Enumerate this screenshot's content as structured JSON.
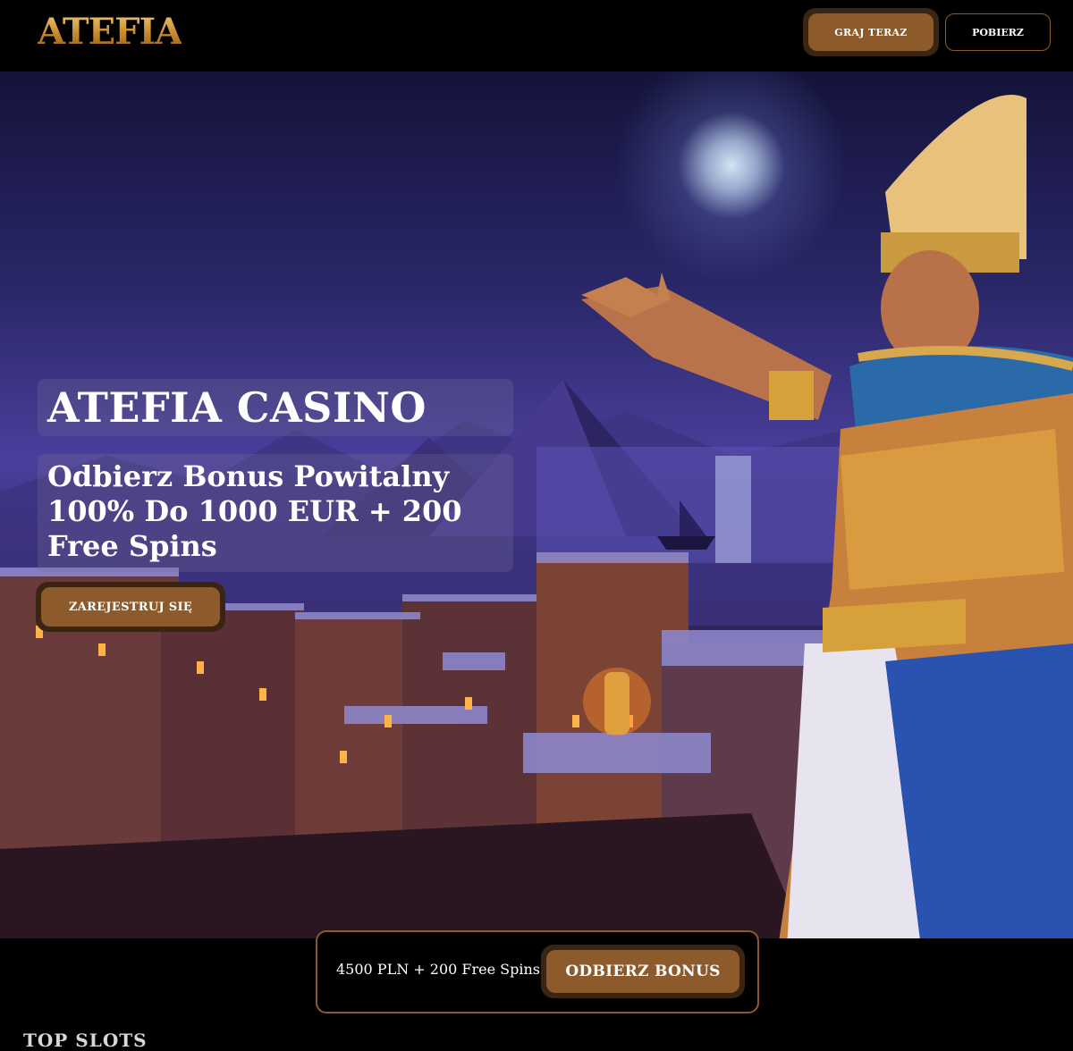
{
  "header": {
    "logo_text": "ATEFIA",
    "play_button_label": "GRAJ TERAZ",
    "download_button_label": "POBIERZ"
  },
  "hero": {
    "title": "ATEFIA CASINO",
    "subtitle": "Odbierz Bonus Powitalny 100% Do 1000 EUR + 200 Free Spins",
    "register_button_label": "ZAREJESTRUJ SIĘ",
    "image_description_icon": "pharaoh-illustration"
  },
  "bonus_bar": {
    "offer_text": "4500 PLN + 200 Free Spins",
    "claim_button_label": "ODBIERZ BONUS"
  },
  "sections": {
    "top_slots_title": "TOP SLOTS"
  },
  "colors": {
    "accent": "#8d5a2b",
    "accent_dark": "#3a2512",
    "logo_gold": "#d9a54a",
    "background": "#000000"
  }
}
